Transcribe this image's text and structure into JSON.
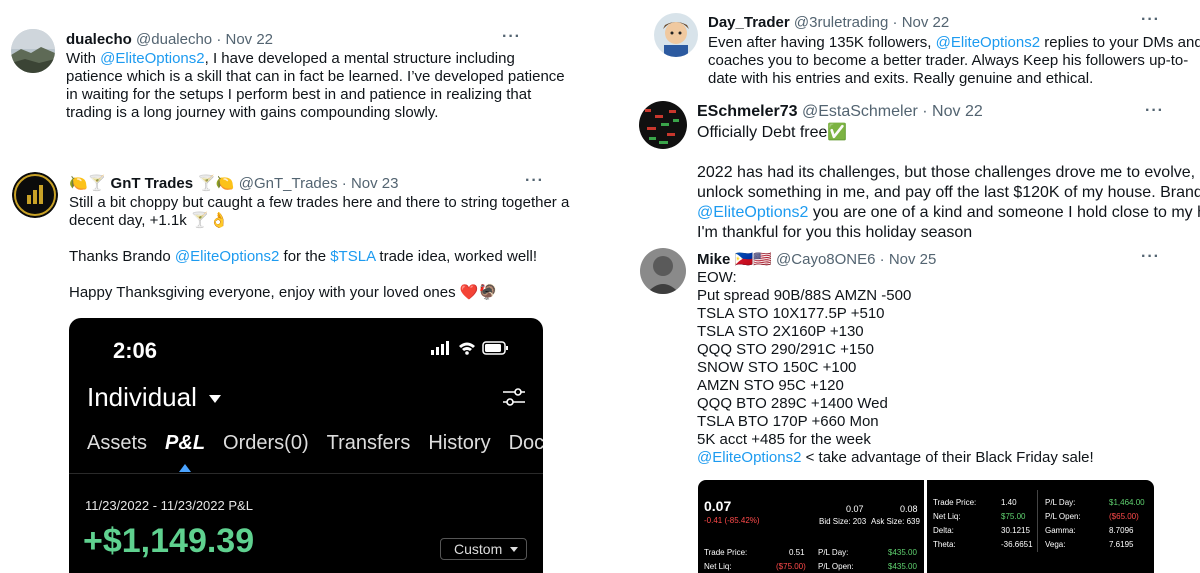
{
  "tweets": {
    "t1": {
      "display_name": "dualecho",
      "handle": "@dualecho",
      "sep": "·",
      "date": "Nov 22",
      "more": "···",
      "lines": [
        [
          {
            "t": "With "
          },
          {
            "t": "@EliteOptions2",
            "link": true
          },
          {
            "t": ", I have developed a mental structure including"
          }
        ],
        [
          {
            "t": "patience which is a skill that can in fact be learned. I’ve developed patience"
          }
        ],
        [
          {
            "t": "in waiting for the setups I perform best in and patience in realizing that"
          }
        ],
        [
          {
            "t": "trading is a long journey with gains compounding slowly."
          }
        ]
      ]
    },
    "t2": {
      "display_name": "🍋🍸 GnT Trades 🍸🍋",
      "handle": "@GnT_Trades",
      "sep": "·",
      "date": "Nov 23",
      "more": "···",
      "lines": [
        [
          {
            "t": "Still a bit choppy but caught a few trades here and there to string together a"
          }
        ],
        [
          {
            "t": "decent day, +1.1k 🍸👌"
          }
        ],
        [],
        [
          {
            "t": "Thanks Brando "
          },
          {
            "t": "@EliteOptions2",
            "link": true
          },
          {
            "t": " for the "
          },
          {
            "t": "$TSLA",
            "link": true
          },
          {
            "t": " trade idea, worked well!"
          }
        ],
        [],
        [
          {
            "t": "Happy Thanksgiving everyone, enjoy with your loved ones ❤️🦃"
          }
        ]
      ],
      "media": {
        "time": "2:06",
        "account": "Individual",
        "tabs": [
          "Assets",
          "P&L",
          "Orders(0)",
          "Transfers",
          "History",
          "Doc"
        ],
        "active_tab": "P&L",
        "date_range": "11/23/2022 - 11/23/2022 P&L",
        "pl_value": "+$1,149.39",
        "range_select": "Custom",
        "accent_color": "#5fd18f"
      }
    },
    "t3": {
      "display_name": "Day_Trader",
      "handle": "@3ruletrading",
      "sep": "·",
      "date": "Nov 22",
      "more": "···",
      "lines": [
        [
          {
            "t": "Even after having 135K followers, "
          },
          {
            "t": "@EliteOptions2",
            "link": true
          },
          {
            "t": " replies to your DMs and"
          }
        ],
        [
          {
            "t": "coaches you to become a better trader. Always Keep his followers up-to-"
          }
        ],
        [
          {
            "t": "date with his entries and exits. Really genuine and ethical."
          }
        ]
      ]
    },
    "t4": {
      "display_name": "ESchmeler73",
      "handle": "@EstaSchmeler",
      "sep": "·",
      "date": "Nov 22",
      "more": "···",
      "lines": [
        [
          {
            "t": "Officially Debt free✅"
          }
        ],
        [],
        [
          {
            "t": "2022 has had its challenges, but those challenges drove me to evolve,"
          }
        ],
        [
          {
            "t": "unlock something in me, and pay off the last $120K of my house. Brando"
          }
        ],
        [
          {
            "t": "@EliteOptions2",
            "link": true
          },
          {
            "t": " you are one of a kind and someone I hold close to my heart."
          }
        ],
        [
          {
            "t": "I'm thankful for you this holiday season"
          }
        ]
      ]
    },
    "t5": {
      "display_name": "Mike 🇵🇭🇺🇸",
      "handle": "@Cayo8ONE6",
      "sep": "·",
      "date": "Nov 25",
      "more": "···",
      "lines": [
        [
          {
            "t": "EOW:"
          }
        ],
        [
          {
            "t": "Put spread 90B/88S AMZN -500"
          }
        ],
        [
          {
            "t": "TSLA STO 10X177.5P +510"
          }
        ],
        [
          {
            "t": "TSLA STO 2X160P +130"
          }
        ],
        [
          {
            "t": "QQQ STO 290/291C +150"
          }
        ],
        [
          {
            "t": "SNOW STO 150C +100"
          }
        ],
        [
          {
            "t": "AMZN STO 95C +120"
          }
        ],
        [
          {
            "t": "QQQ BTO 289C +1400 Wed"
          }
        ],
        [
          {
            "t": "TSLA BTO 170P +660 Mon"
          }
        ],
        [
          {
            "t": "5K acct +485 for the week"
          }
        ],
        [
          {
            "t": "@EliteOptions2",
            "link": true
          },
          {
            "t": " < take advantage of their Black Friday sale!"
          }
        ]
      ],
      "media": {
        "left": {
          "price": "0.07",
          "change": "-0.41 (-85.42%)",
          "bid": "0.07",
          "ask": "0.08",
          "bid_size": "Bid Size: 203",
          "ask_size": "Ask Size: 639",
          "trade_price_label": "Trade Price:",
          "trade_price": "0.51",
          "pl_day_label": "P/L Day:",
          "pl_day": "$435.00",
          "net_liq_label": "Net Liq:",
          "net_liq": "($75.00)",
          "pl_open_label": "P/L Open:",
          "pl_open": "$435.00"
        },
        "right": {
          "rows": [
            {
              "k1": "Trade Price:",
              "v1": "1.40",
              "k2": "P/L Day:",
              "v2": "$1,464.00",
              "c1": "",
              "c2": "green"
            },
            {
              "k1": "Net Liq:",
              "v1": "$75.00",
              "k2": "P/L Open:",
              "v2": "($65.00)",
              "c1": "green",
              "c2": "red"
            },
            {
              "k1": "Delta:",
              "v1": "30.1215",
              "k2": "Gamma:",
              "v2": "8.7096",
              "c1": "",
              "c2": ""
            },
            {
              "k1": "Theta:",
              "v1": "-36.6651",
              "k2": "Vega:",
              "v2": "7.6195",
              "c1": "",
              "c2": ""
            }
          ]
        }
      }
    }
  },
  "colors": {
    "link": "#1d9bf0",
    "muted": "#536471",
    "green": "#5fd16f",
    "red": "#ff4a4a"
  }
}
